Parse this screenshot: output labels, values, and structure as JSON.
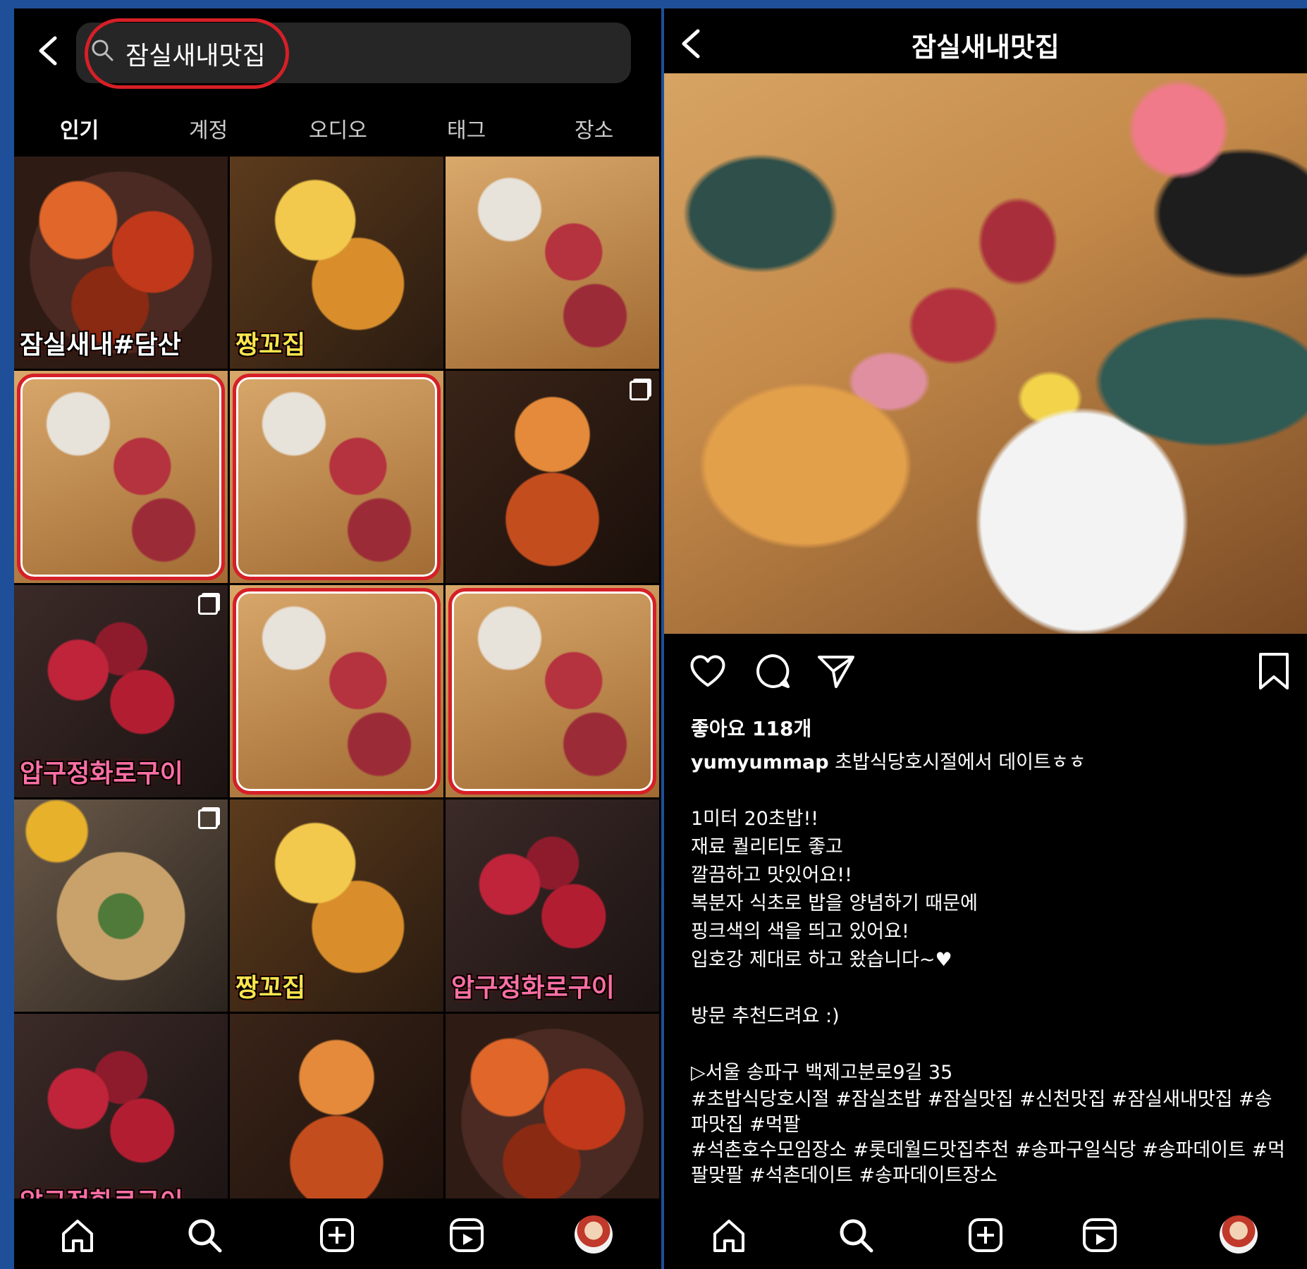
{
  "search": {
    "query": "잠실새내맛집",
    "tabs": [
      {
        "label": "인기",
        "active": true
      },
      {
        "label": "계정",
        "active": false
      },
      {
        "label": "오디오",
        "active": false
      },
      {
        "label": "태그",
        "active": false
      },
      {
        "label": "장소",
        "active": false
      }
    ],
    "grid": [
      {
        "caption": "잠실새내#담산",
        "style": "food-red",
        "highlight": false
      },
      {
        "caption": "짱꼬집",
        "style": "food-yellow",
        "highlight": false
      },
      {
        "caption": "",
        "style": "food-sushi",
        "highlight": false
      },
      {
        "caption": "",
        "style": "food-sushi",
        "highlight": true
      },
      {
        "caption": "",
        "style": "food-sushi",
        "highlight": true
      },
      {
        "caption": "",
        "style": "food-noodle",
        "highlight": false
      },
      {
        "caption": "압구정화로구이",
        "style": "food-beef",
        "highlight": false
      },
      {
        "caption": "",
        "style": "food-sushi",
        "highlight": true
      },
      {
        "caption": "",
        "style": "food-sushi",
        "highlight": true
      },
      {
        "caption": "",
        "style": "food-pancake",
        "highlight": false
      },
      {
        "caption": "짱꼬집",
        "style": "food-yellow",
        "highlight": false
      },
      {
        "caption": "압구정화로구이",
        "style": "food-beef",
        "highlight": false
      },
      {
        "caption": "압구정화로구이",
        "style": "food-beef",
        "highlight": false
      },
      {
        "caption": "",
        "style": "food-noodle",
        "highlight": false
      },
      {
        "caption": "",
        "style": "food-red",
        "highlight": false
      }
    ]
  },
  "post": {
    "title": "잠실새내맛집",
    "likes": "좋아요 118개",
    "username": "yumyummap",
    "headline": " 초밥식당호시절에서 데이트ㅎㅎ",
    "body": "\n1미터 20초밥!!\n재료 퀄리티도 좋고\n깔끔하고 맛있어요!!\n복분자 식초로 밥을 양념하기 때문에\n핑크색의 색을 띄고 있어요!\n입호강 제대로 하고 왔습니다~♥\n\n방문 추천드려요 :)\n\n▷서울 송파구 백제고분로9길 35",
    "hashtags": "#초밥식당호시절 #잠실초밥 #잠실맛집 #신천맛집 #잠실새내맛집 #송파맛집 #먹팔\n#석촌호수모임장소 #롯데월드맛집추천 #송파구일식당 #송파데이트 #먹팔맞팔 #석촌데이트 #송파데이트장소"
  },
  "colors": {
    "highlight": "#d61f27",
    "frame": "#1e4f98"
  }
}
